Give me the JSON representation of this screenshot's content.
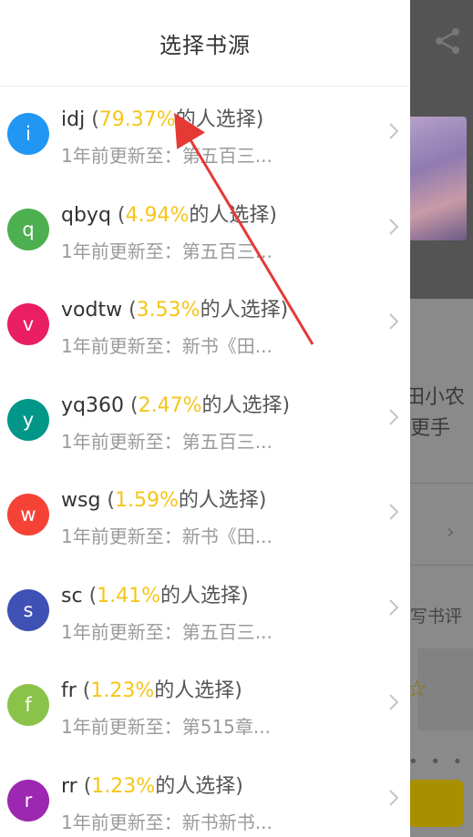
{
  "background": {
    "visible_text": [
      "田小农",
      "更手",
      "写书评"
    ]
  },
  "drawer": {
    "title": "选择书源",
    "suffix_text": "的人选择",
    "items": [
      {
        "name": "idj",
        "letter": "i",
        "percent": "79.37%",
        "update": "1年前更新至：第五百三...",
        "color": "#2196f3"
      },
      {
        "name": "qbyq",
        "letter": "q",
        "percent": "4.94%",
        "update": "1年前更新至：第五百三...",
        "color": "#4caf50"
      },
      {
        "name": "vodtw",
        "letter": "v",
        "percent": "3.53%",
        "update": "1年前更新至：新书《田...",
        "color": "#e91e63"
      },
      {
        "name": "yq360",
        "letter": "y",
        "percent": "2.47%",
        "update": "1年前更新至：第五百三...",
        "color": "#009688"
      },
      {
        "name": "wsg",
        "letter": "w",
        "percent": "1.59%",
        "update": "1年前更新至：新书《田...",
        "color": "#f44336"
      },
      {
        "name": "sc",
        "letter": "s",
        "percent": "1.41%",
        "update": "1年前更新至：第五百三...",
        "color": "#3f51b5"
      },
      {
        "name": "fr",
        "letter": "f",
        "percent": "1.23%",
        "update": "1年前更新至：第515章...",
        "color": "#8bc34a"
      },
      {
        "name": "rr",
        "letter": "r",
        "percent": "1.23%",
        "update": "1年前更新至：新书新书...",
        "color": "#9c27b0"
      }
    ]
  },
  "colors": {
    "percent_highlight": "#f5c518",
    "annotation_arrow": "#e53935"
  },
  "icons": {
    "share": "share-icon",
    "chevron": "chevron-right-icon",
    "star": "star-icon"
  }
}
